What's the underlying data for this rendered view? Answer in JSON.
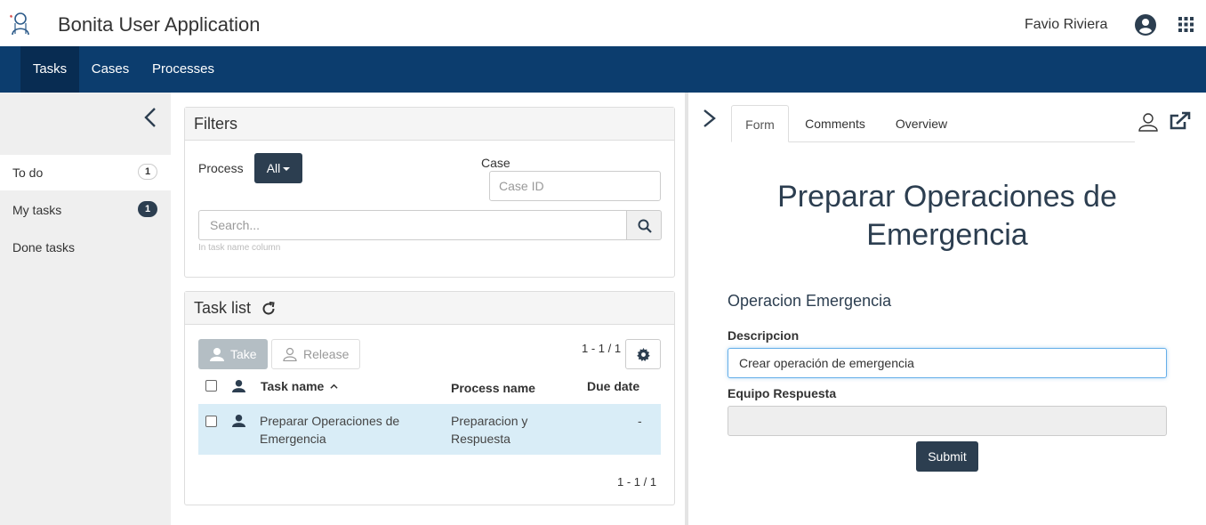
{
  "header": {
    "app_title": "Bonita User Application",
    "user_name": "Favio Riviera",
    "logo_icon": "bonita-logo-icon",
    "avatar_icon": "user-circle-icon",
    "apps_icon": "grid-icon"
  },
  "nav": {
    "items": [
      {
        "label": "Tasks",
        "active": true
      },
      {
        "label": "Cases",
        "active": false
      },
      {
        "label": "Processes",
        "active": false
      }
    ]
  },
  "sidebar": {
    "items": [
      {
        "label": "To do",
        "count": "1",
        "active": true
      },
      {
        "label": "My tasks",
        "count": "1",
        "active": false
      },
      {
        "label": "Done tasks",
        "count": null,
        "active": false
      }
    ]
  },
  "filters": {
    "title": "Filters",
    "process_label": "Process",
    "process_value": "All",
    "case_label": "Case",
    "case_placeholder": "Case ID",
    "search_placeholder": "Search...",
    "search_hint": "In task name column"
  },
  "tasklist": {
    "title": "Task list",
    "take_label": "Take",
    "release_label": "Release",
    "pager_top": "1 - 1 / 1",
    "pager_bottom": "1 - 1 / 1",
    "columns": [
      "Task name",
      "Process name",
      "Due date"
    ],
    "rows": [
      {
        "task": "Preparar Operaciones de Emergencia",
        "process": "Preparacion y Respuesta",
        "due": "-"
      }
    ]
  },
  "detail": {
    "tabs": [
      "Form",
      "Comments",
      "Overview"
    ],
    "active_tab": "Form",
    "form_title": "Preparar Operaciones de Emergencia",
    "section_title": "Operacion Emergencia",
    "descripcion_label": "Descripcion",
    "descripcion_value": "Crear operación de emergencia",
    "equipo_label": "Equipo Respuesta",
    "equipo_value": "",
    "submit_label": "Submit"
  },
  "colors": {
    "nav_bg": "#0c3d6e",
    "nav_active": "#082c52",
    "primary_dark": "#2c3e50",
    "row_selected": "#d9edf7"
  }
}
